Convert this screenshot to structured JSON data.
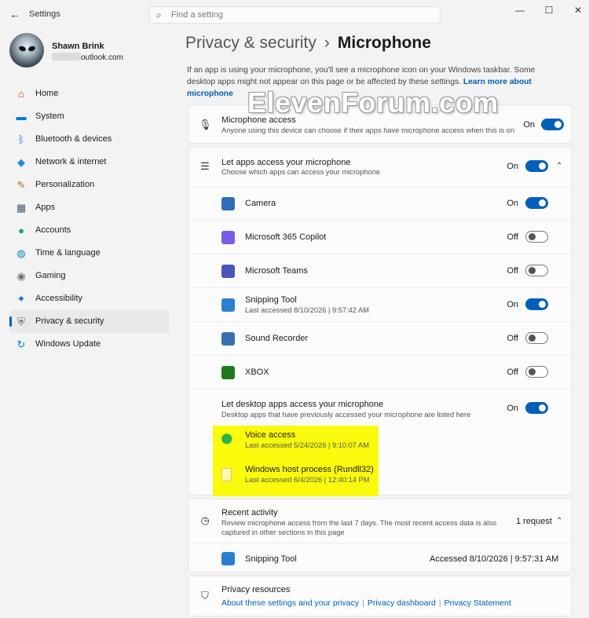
{
  "window": {
    "app_title": "Settings",
    "search_placeholder": "Find a setting",
    "controls": [
      "—",
      "☐",
      "✕"
    ]
  },
  "profile": {
    "name": "Shawn Brink",
    "email_suffix": "outlook.com"
  },
  "nav": [
    {
      "label": "Home",
      "icon": "home-icon",
      "glyph": "⌂",
      "color": "#c2410c",
      "active": false
    },
    {
      "label": "System",
      "icon": "monitor-icon",
      "glyph": "▬",
      "color": "#0078d4",
      "active": false
    },
    {
      "label": "Bluetooth & devices",
      "icon": "bluetooth-icon",
      "glyph": "ᛒ",
      "color": "#0078d4",
      "active": false
    },
    {
      "label": "Network & internet",
      "icon": "wifi-icon",
      "glyph": "◆",
      "color": "#1c8fe0",
      "active": false
    },
    {
      "label": "Personalization",
      "icon": "brush-icon",
      "glyph": "✎",
      "color": "#b87333",
      "active": false
    },
    {
      "label": "Apps",
      "icon": "apps-icon",
      "glyph": "▦",
      "color": "#4a5a6a",
      "active": false
    },
    {
      "label": "Accounts",
      "icon": "person-icon",
      "glyph": "●",
      "color": "#1a9e7a",
      "active": false
    },
    {
      "label": "Time & language",
      "icon": "globe-clock-icon",
      "glyph": "◍",
      "color": "#0a84c6",
      "active": false
    },
    {
      "label": "Gaming",
      "icon": "gamepad-icon",
      "glyph": "◉",
      "color": "#707070",
      "active": false
    },
    {
      "label": "Accessibility",
      "icon": "accessibility-icon",
      "glyph": "✦",
      "color": "#1570d0",
      "active": false
    },
    {
      "label": "Privacy & security",
      "icon": "shield-icon",
      "glyph": "⛨",
      "color": "#5a6a78",
      "active": true
    },
    {
      "label": "Windows Update",
      "icon": "update-icon",
      "glyph": "↻",
      "color": "#0078d4",
      "active": false
    }
  ],
  "header": {
    "parent": "Privacy & security",
    "separator": "›",
    "current": "Microphone",
    "intro": "If an app is using your microphone, you'll see a microphone icon on your Windows taskbar. Some desktop apps might not appear on this page or be affected by these settings.",
    "intro_link": "Learn more about microphone"
  },
  "watermark": "ElevenForum.com",
  "mic_access": {
    "title": "Microphone access",
    "desc": "Anyone using this device can choose if their apps have microphone access when this is on",
    "state": "On"
  },
  "apps_access": {
    "title": "Let apps access your microphone",
    "desc": "Choose which apps can access your microphone",
    "state": "On",
    "apps": [
      {
        "name": "Camera",
        "last": "",
        "state": "On",
        "icon": "camera-app-icon",
        "color": "#2f6db8"
      },
      {
        "name": "Microsoft 365 Copilot",
        "last": "",
        "state": "Off",
        "icon": "copilot-app-icon",
        "color": "#7b5ce6"
      },
      {
        "name": "Microsoft Teams",
        "last": "",
        "state": "Off",
        "icon": "teams-app-icon",
        "color": "#4b53bc"
      },
      {
        "name": "Snipping Tool",
        "last": "Last accessed 8/10/2026  |  9:57:42 AM",
        "state": "On",
        "icon": "snipping-tool-icon",
        "color": "#2a7fd4"
      },
      {
        "name": "Sound Recorder",
        "last": "",
        "state": "Off",
        "icon": "sound-recorder-icon",
        "color": "#3a6fb0"
      },
      {
        "name": "XBOX",
        "last": "",
        "state": "Off",
        "icon": "xbox-app-icon",
        "color": "#1f7a1f"
      }
    ]
  },
  "desktop_access": {
    "title": "Let desktop apps access your microphone",
    "desc": "Desktop apps that have previously accessed your microphone are listed here",
    "state": "On",
    "apps": [
      {
        "name": "Voice access",
        "last": "Last accessed 5/24/2026  |  9:10:07 AM",
        "icon": "voice-access-icon"
      },
      {
        "name": "Windows host process (Rundll32)",
        "last": "Last accessed 6/4/2026  |  12:40:14 PM",
        "icon": "file-icon"
      }
    ]
  },
  "recent": {
    "title": "Recent activity",
    "desc_line1": "Review microphone access from the last 7 days. The most recent access data is also",
    "desc_line2": "captured in other sections in this page",
    "count": "1 request",
    "items": [
      {
        "name": "Snipping Tool",
        "accessed": "Accessed 8/10/2026  |  9:57:31 AM"
      }
    ]
  },
  "resources": {
    "title": "Privacy resources",
    "links": [
      "About these settings and your privacy",
      "Privacy dashboard",
      "Privacy Statement"
    ]
  }
}
